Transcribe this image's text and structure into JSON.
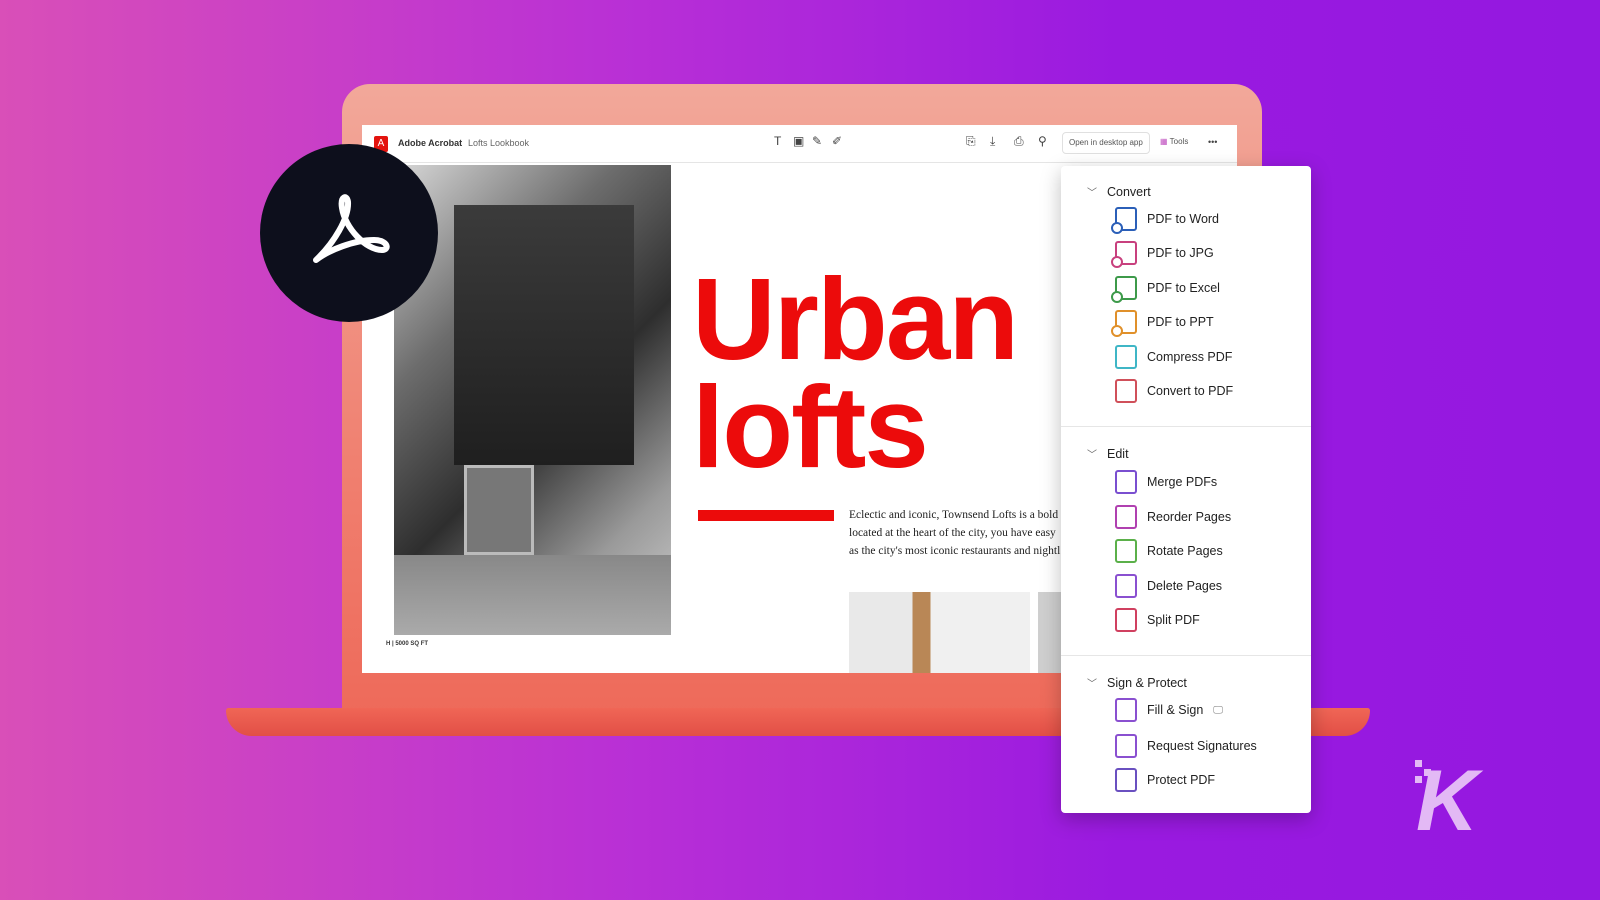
{
  "toolbar": {
    "app_name": "Adobe Acrobat",
    "doc_name": "Lofts Lookbook",
    "open_desktop": "Open in desktop app",
    "tools": "Tools",
    "more": "•••"
  },
  "document": {
    "headline_line1": "Urban",
    "headline_line2": "lofts",
    "caption": "H | 5000 SQ FT",
    "paragraph": [
      "Eclectic and iconic, Townsend Lofts is a bold",
      "located at the heart of the city, you have easy",
      "as the city's most iconic restaurants and nightl"
    ]
  },
  "panel": {
    "sections": [
      {
        "title": "Convert",
        "items": [
          {
            "label": "PDF to Word",
            "icon": "pdf-to-word-icon",
            "color": "#2b5fb8"
          },
          {
            "label": "PDF to JPG",
            "icon": "pdf-to-jpg-icon",
            "color": "#c8407e"
          },
          {
            "label": "PDF to Excel",
            "icon": "pdf-to-excel-icon",
            "color": "#3d9a4a"
          },
          {
            "label": "PDF to PPT",
            "icon": "pdf-to-ppt-icon",
            "color": "#e0902a"
          },
          {
            "label": "Compress PDF",
            "icon": "compress-pdf-icon",
            "color": "#3fb6c6"
          },
          {
            "label": "Convert to PDF",
            "icon": "convert-to-pdf-icon",
            "color": "#d0505a"
          }
        ]
      },
      {
        "title": "Edit",
        "items": [
          {
            "label": "Merge PDFs",
            "icon": "merge-pdfs-icon",
            "color": "#7a4fd0"
          },
          {
            "label": "Reorder Pages",
            "icon": "reorder-pages-icon",
            "color": "#b040b0"
          },
          {
            "label": "Rotate Pages",
            "icon": "rotate-pages-icon",
            "color": "#5bb04a"
          },
          {
            "label": "Delete Pages",
            "icon": "delete-pages-icon",
            "color": "#8a50d0"
          },
          {
            "label": "Split PDF",
            "icon": "split-pdf-icon",
            "color": "#d04060"
          }
        ]
      },
      {
        "title": "Sign & Protect",
        "items": [
          {
            "label": "Fill & Sign",
            "icon": "fill-sign-icon",
            "color": "#8a50d0"
          },
          {
            "label": "Request Signatures",
            "icon": "request-signatures-icon",
            "color": "#8a50d0"
          },
          {
            "label": "Protect PDF",
            "icon": "protect-pdf-icon",
            "color": "#6a50c0"
          }
        ]
      }
    ]
  },
  "colors": {
    "accent_red": "#ec0b0b",
    "background_left": "#d94fb8",
    "background_right": "#9418e0",
    "laptop": "#f08070"
  },
  "watermark": "K"
}
